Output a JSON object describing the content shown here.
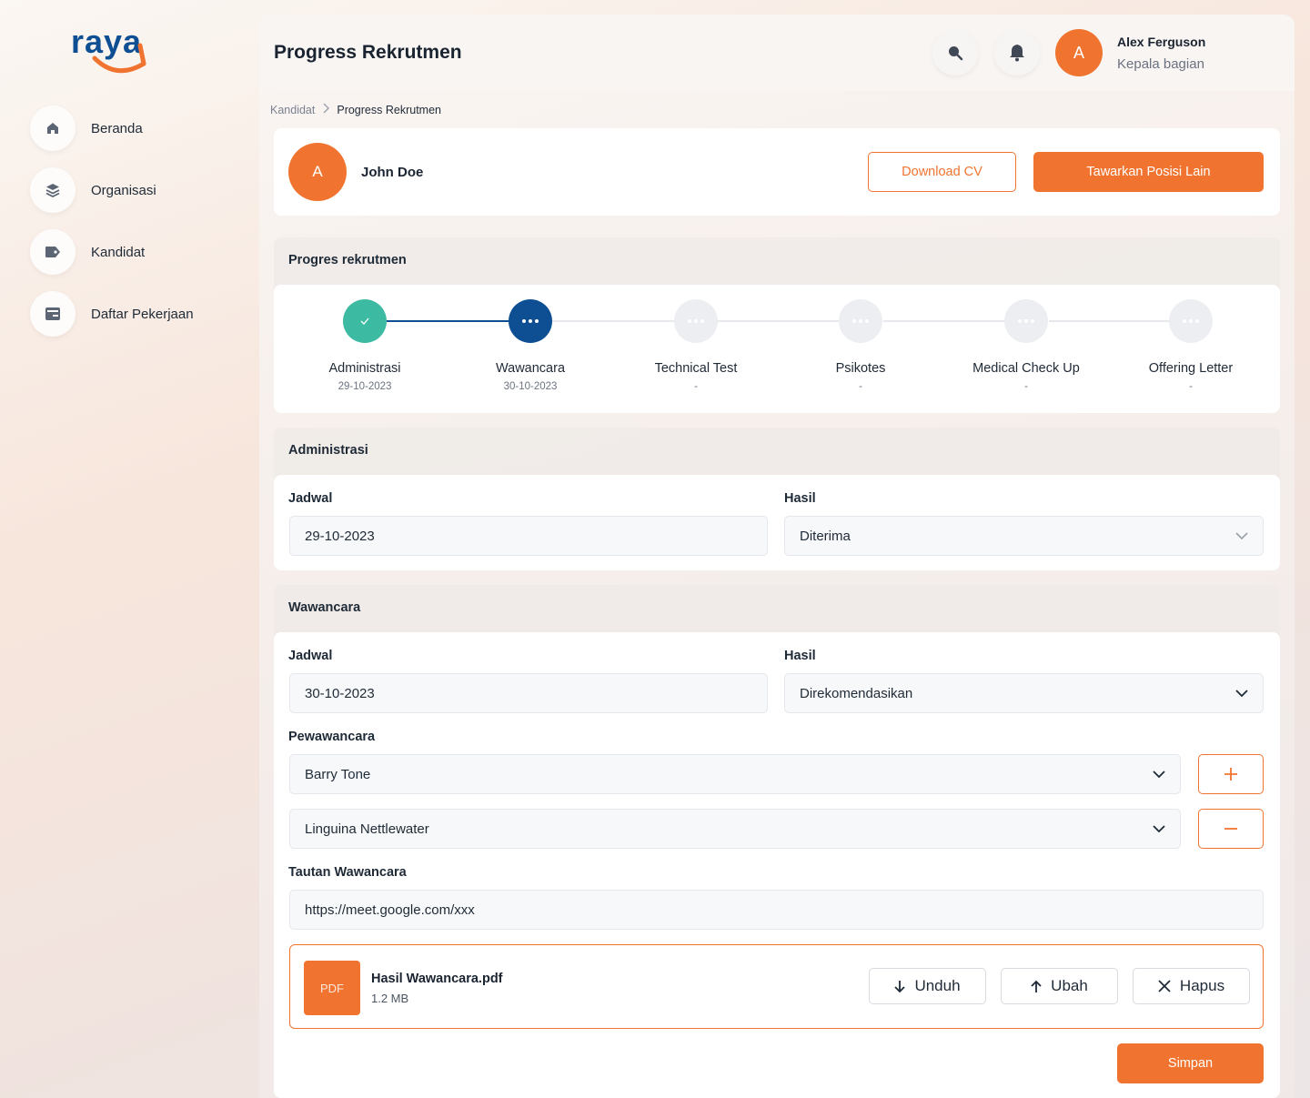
{
  "brand": {
    "logo_text": "raya",
    "primary_color": "#f07430",
    "accent_blue": "#0e4f94",
    "success_color": "#3dbaa2"
  },
  "sidebar": {
    "items": [
      {
        "label": "Beranda",
        "icon": "home-icon"
      },
      {
        "label": "Organisasi",
        "icon": "layers-icon"
      },
      {
        "label": "Kandidat",
        "icon": "tag-icon"
      },
      {
        "label": "Daftar Pekerjaan",
        "icon": "briefcase-icon"
      }
    ]
  },
  "header": {
    "title": "Progress Rekrutmen",
    "user": {
      "initial": "A",
      "name": "Alex Ferguson",
      "role": "Kepala bagian"
    }
  },
  "breadcrumb": {
    "parent": "Kandidat",
    "current": "Progress Rekrutmen"
  },
  "candidate": {
    "initial": "A",
    "name": "John Doe",
    "download_label": "Download CV",
    "offer_label": "Tawarkan Posisi Lain"
  },
  "progress": {
    "title": "Progres rekrutmen",
    "steps": [
      {
        "name": "Administrasi",
        "date": "29-10-2023",
        "status": "done"
      },
      {
        "name": "Wawancara",
        "date": "30-10-2023",
        "status": "current"
      },
      {
        "name": "Technical Test",
        "date": "-",
        "status": "pending"
      },
      {
        "name": "Psikotes",
        "date": "-",
        "status": "pending"
      },
      {
        "name": "Medical Check Up",
        "date": "-",
        "status": "pending"
      },
      {
        "name": "Offering Letter",
        "date": "-",
        "status": "pending"
      }
    ]
  },
  "administrasi": {
    "title": "Administrasi",
    "schedule_label": "Jadwal",
    "schedule_value": "29-10-2023",
    "result_label": "Hasil",
    "result_value": "Diterima"
  },
  "wawancara": {
    "title": "Wawancara",
    "schedule_label": "Jadwal",
    "schedule_value": "30-10-2023",
    "result_label": "Hasil",
    "result_value": "Direkomendasikan",
    "interviewer_label": "Pewawancara",
    "interviewers": [
      "Barry Tone",
      "Linguina Nettlewater"
    ],
    "link_label": "Tautan Wawancara",
    "link_value": "https://meet.google.com/xxx",
    "file": {
      "type": "PDF",
      "name": "Hasil Wawancara.pdf",
      "size": "1.2 MB",
      "download_label": "Unduh",
      "change_label": "Ubah",
      "delete_label": "Hapus"
    },
    "save_label": "Simpan"
  }
}
